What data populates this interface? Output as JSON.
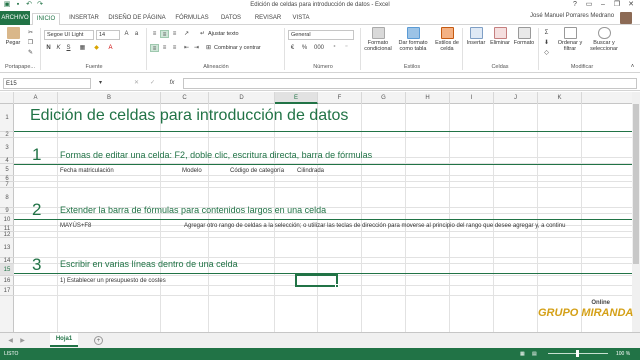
{
  "window": {
    "title": "Edición de celdas para introducción de datos - Excel"
  },
  "ribbon_tabs": [
    "ARCHIVO",
    "INICIO",
    "INSERTAR",
    "DISEÑO DE PÁGINA",
    "FÓRMULAS",
    "DATOS",
    "REVISAR",
    "VISTA"
  ],
  "user": {
    "name": "José Manuel Porrares Medrano"
  },
  "clipboard": {
    "paste_label": "Pegar",
    "group_label": "Portapape..."
  },
  "font": {
    "name": "Segoe UI Light",
    "size": "14",
    "bold": "N",
    "italic": "K",
    "underline": "S",
    "group_label": "Fuente"
  },
  "alignment": {
    "wrap_label": "Ajustar texto",
    "merge_label": "Combinar y centrar",
    "group_label": "Alineación"
  },
  "number": {
    "format": "General",
    "group_label": "Número",
    "currency": "%",
    "thousands": "000"
  },
  "styles": {
    "conditional": "Formato condicional",
    "as_table": "Dar formato como tabla",
    "cell_styles": "Estilos de celda",
    "group_label": "Estilos"
  },
  "cells_group": {
    "insert": "Insertar",
    "delete": "Eliminar",
    "format": "Formato",
    "group_label": "Celdas"
  },
  "modify": {
    "sort": "Ordenar y filtrar",
    "find": "Buscar y seleccionar",
    "group_label": "Modificar"
  },
  "formula_bar": {
    "name_box": "E15",
    "fx": "fx",
    "content": ""
  },
  "columns": [
    "A",
    "B",
    "C",
    "D",
    "E",
    "F",
    "G",
    "H",
    "I",
    "J",
    "K"
  ],
  "selected_column": "E",
  "rows": [
    "1",
    "2",
    "3",
    "4",
    "5",
    "6",
    "7",
    "8",
    "9",
    "10",
    "11",
    "12",
    "13",
    "14",
    "15",
    "16",
    "17"
  ],
  "selected_row": "15",
  "sheet": {
    "banner": "Edición de celdas para introducción de datos",
    "sections": [
      {
        "number": "1",
        "heading": "Formas de editar una celda: F2, doble clic, escritura directa, barra de fórmulas"
      },
      {
        "number": "2",
        "heading": "Extender la barra de fórmulas para contenidos largos en una celda"
      },
      {
        "number": "3",
        "heading": "Escribir en varias líneas dentro de una celda"
      }
    ],
    "row5": [
      "Fecha matriculación",
      "Modelo",
      "Código de categoría",
      "Cilindrada"
    ],
    "row10_b": "MAYÚS+F8",
    "row10_c": "Agregar otro rango de celdas a la selección; o utilizar las teclas de dirección para moverse al principio del rango que desee agregar y, a continu",
    "row15_b": "1) Establecer un presupuesto de costes"
  },
  "sheet_tab": "Hoja1",
  "status": {
    "left": "LISTO",
    "zoom": "100 %"
  },
  "watermark": {
    "brand": "GRUPO MIRANDA",
    "online": "Online"
  },
  "colors": {
    "accent": "#217346",
    "banner_text": "#217346"
  }
}
